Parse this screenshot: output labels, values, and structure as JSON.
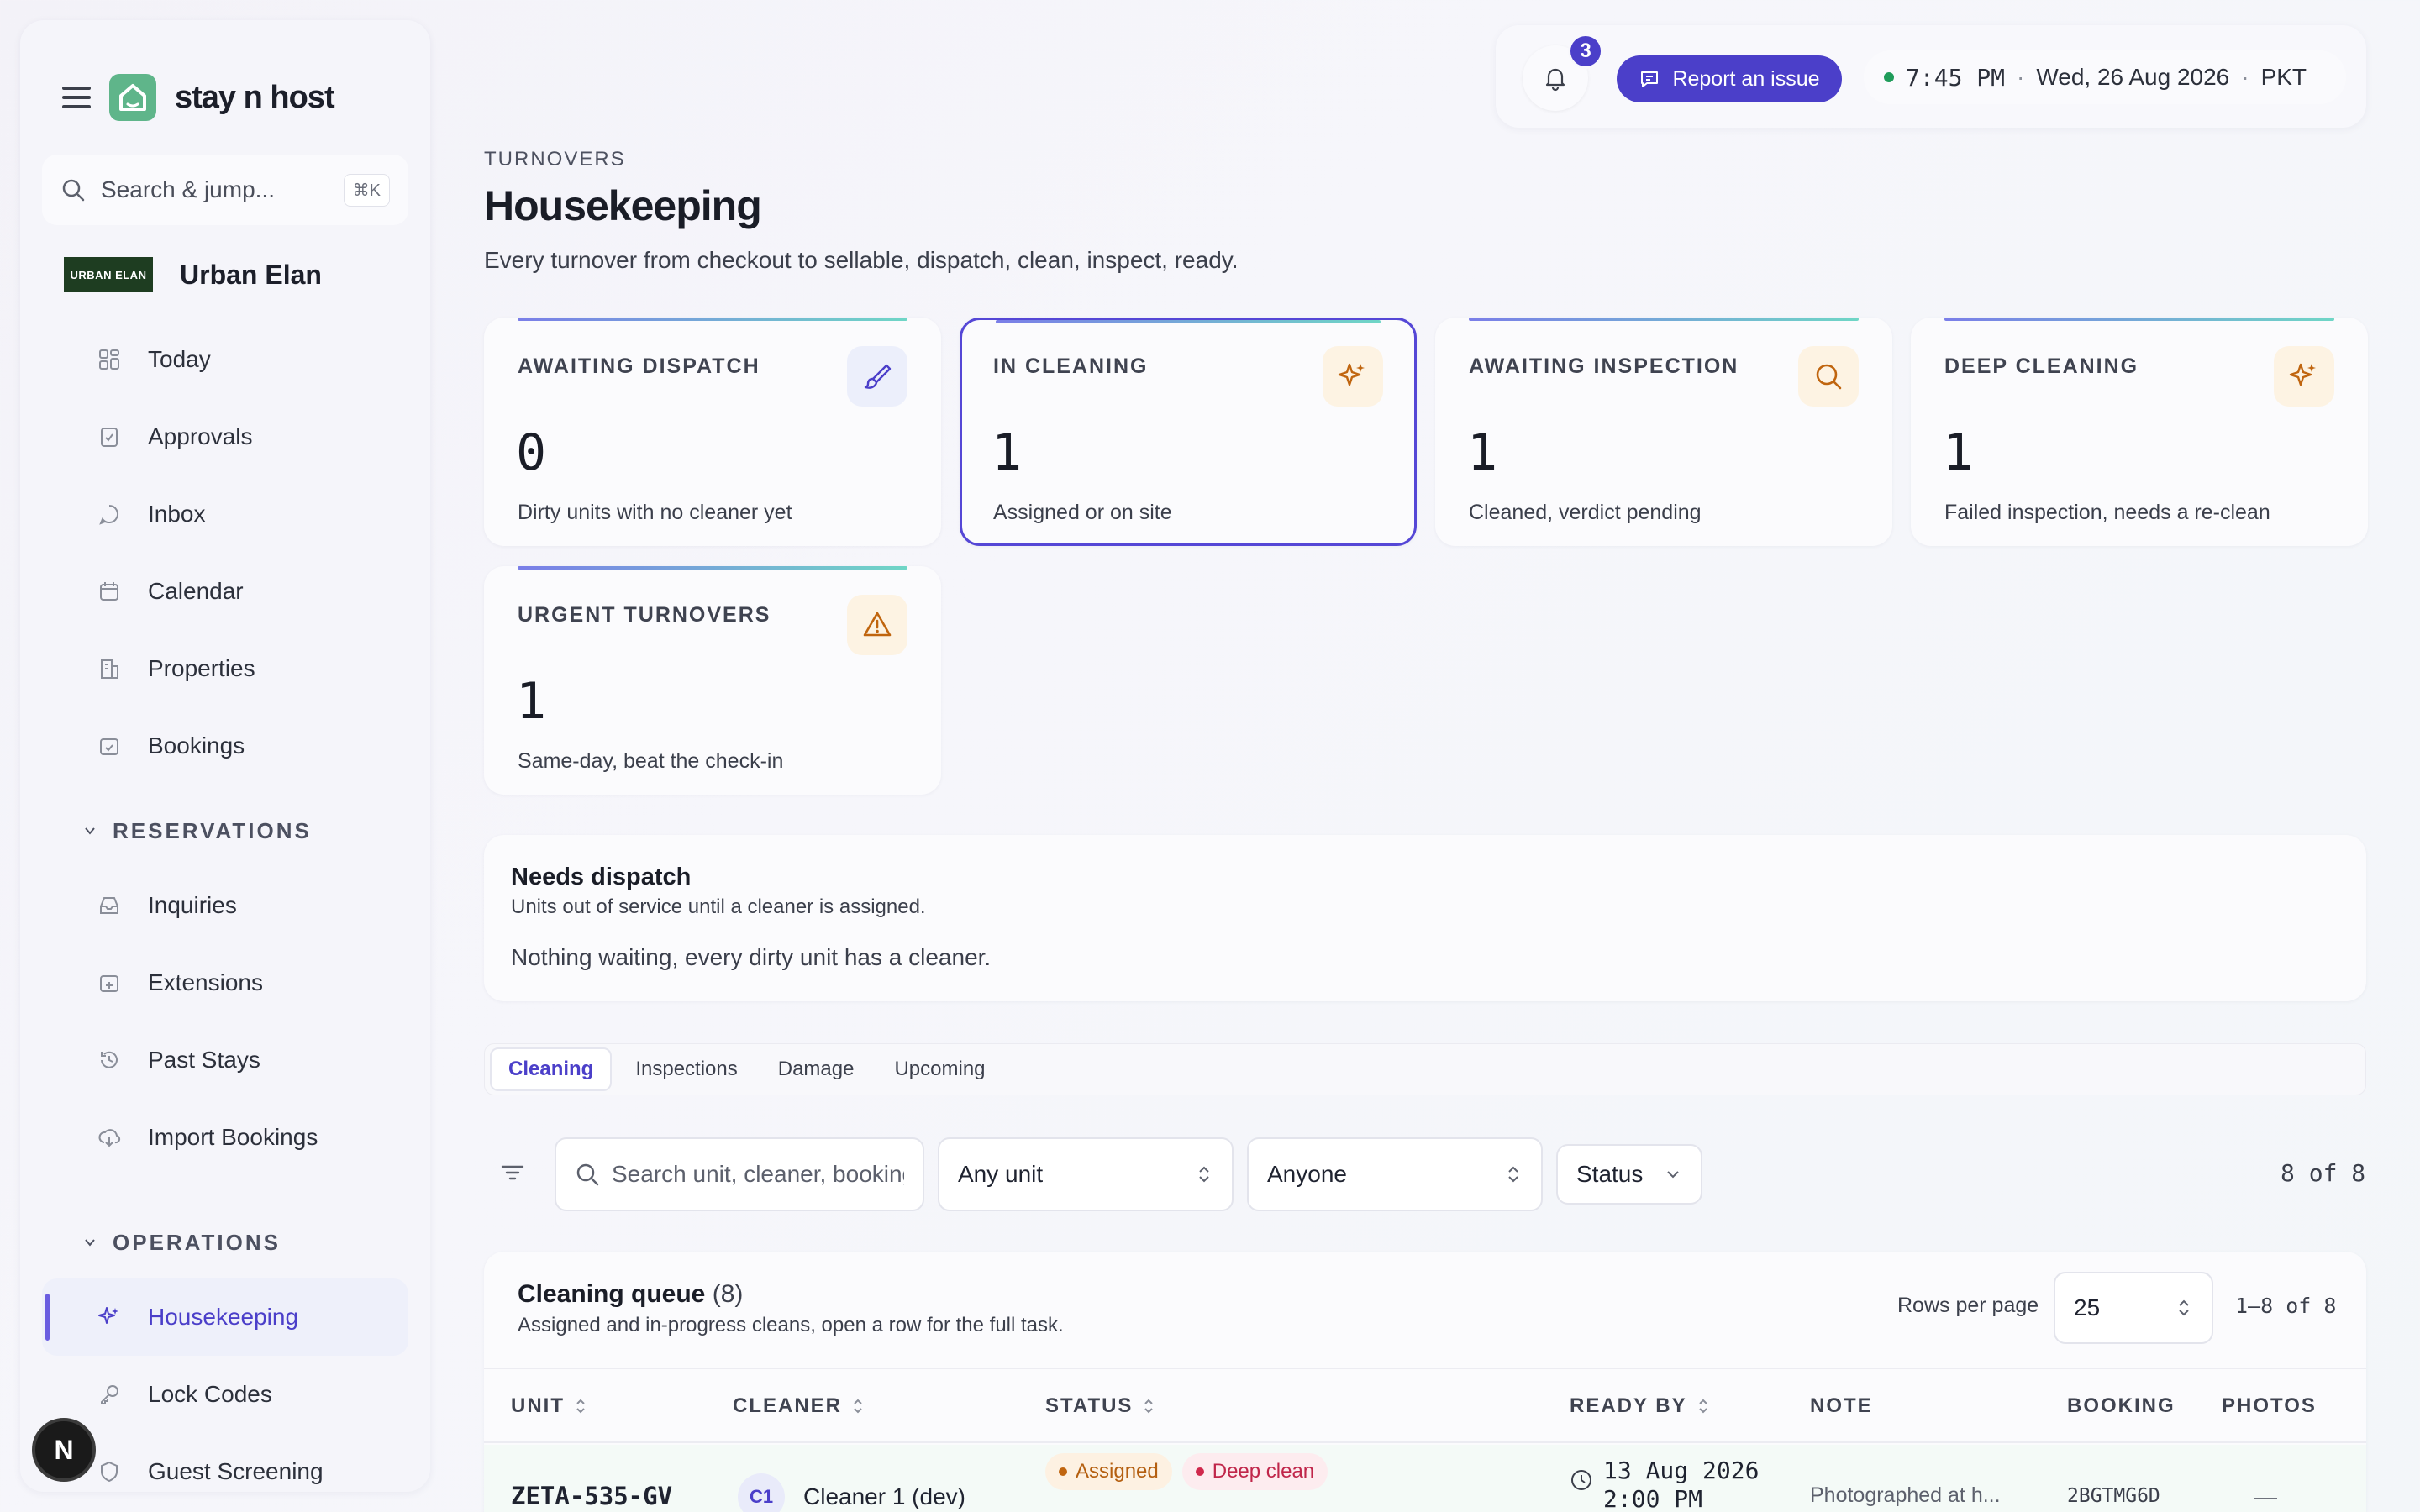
{
  "app": {
    "brand": "stay n host"
  },
  "sidebar": {
    "search_placeholder": "Search & jump...",
    "search_shortcut": "⌘K",
    "org_logo_text": "URBAN ELAN",
    "org_name": "Urban Elan",
    "items_top": [
      {
        "label": "Today",
        "icon": "grid-icon"
      },
      {
        "label": "Approvals",
        "icon": "clipboard-check-icon"
      },
      {
        "label": "Inbox",
        "icon": "chat-icon"
      },
      {
        "label": "Calendar",
        "icon": "calendar-icon"
      },
      {
        "label": "Properties",
        "icon": "building-icon"
      },
      {
        "label": "Bookings",
        "icon": "calendar-check-icon"
      }
    ],
    "section_reservations": "RESERVATIONS",
    "items_reservations": [
      {
        "label": "Inquiries",
        "icon": "inbox-tray-icon"
      },
      {
        "label": "Extensions",
        "icon": "calendar-plus-icon"
      },
      {
        "label": "Past Stays",
        "icon": "history-icon"
      },
      {
        "label": "Import Bookings",
        "icon": "cloud-download-icon"
      }
    ],
    "section_operations": "OPERATIONS",
    "items_operations": [
      {
        "label": "Housekeeping",
        "icon": "sparkle-icon",
        "active": true
      },
      {
        "label": "Lock Codes",
        "icon": "key-icon"
      },
      {
        "label": "Guest Screening",
        "icon": "shield-icon"
      }
    ],
    "user_initial": "N"
  },
  "topbar": {
    "notifications_count": "3",
    "report_label": "Report an issue",
    "time": "7:45 PM",
    "date": "Wed, 26 Aug 2026",
    "timezone": "PKT",
    "separator": "·"
  },
  "header": {
    "eyebrow": "TURNOVERS",
    "title": "Housekeeping",
    "subtitle": "Every turnover from checkout to sellable, dispatch, clean, inspect, ready."
  },
  "stats": [
    {
      "label": "AWAITING DISPATCH",
      "value": "0",
      "desc": "Dirty units with no cleaner yet",
      "icon": "brush-icon",
      "icon_bg": "#eceffb",
      "icon_color": "#4b3fc9"
    },
    {
      "label": "IN CLEANING",
      "value": "1",
      "desc": "Assigned or on site",
      "icon": "sparkle-icon",
      "icon_bg": "#fdf3e3",
      "icon_color": "#c0650f"
    },
    {
      "label": "AWAITING INSPECTION",
      "value": "1",
      "desc": "Cleaned, verdict pending",
      "icon": "search-icon",
      "icon_bg": "#fdf3e3",
      "icon_color": "#c0650f"
    },
    {
      "label": "DEEP CLEANING",
      "value": "1",
      "desc": "Failed inspection, needs a re-clean",
      "icon": "sparkle-icon",
      "icon_bg": "#fdf3e3",
      "icon_color": "#c0650f"
    },
    {
      "label": "URGENT TURNOVERS",
      "value": "1",
      "desc": "Same-day, beat the check-in",
      "icon": "warning-icon",
      "icon_bg": "#fdf3e3",
      "icon_color": "#c0650f"
    }
  ],
  "dispatch": {
    "title": "Needs dispatch",
    "subtitle": "Units out of service until a cleaner is assigned.",
    "empty": "Nothing waiting, every dirty unit has a cleaner."
  },
  "tabs": [
    "Cleaning",
    "Inspections",
    "Damage",
    "Upcoming"
  ],
  "filters": {
    "search_placeholder": "Search unit, cleaner, booking",
    "unit": "Any unit",
    "assignee": "Anyone",
    "status": "Status",
    "count": "8 of 8"
  },
  "queue": {
    "title": "Cleaning queue",
    "count": "(8)",
    "subtitle": "Assigned and in-progress cleans, open a row for the full task.",
    "rows_per_page_label": "Rows per page",
    "rows_per_page": "25",
    "range": "1–8 of 8",
    "columns": [
      "UNIT",
      "CLEANER",
      "STATUS",
      "READY BY",
      "NOTE",
      "BOOKING",
      "PHOTOS"
    ],
    "rows": [
      {
        "unit": "ZETA-535-GV",
        "cleaner_initials": "C1",
        "cleaner": "Cleaner 1 (dev)",
        "status": "Assigned",
        "tag": "Deep clean",
        "ready_date": "13 Aug 2026",
        "ready_time": "2:00 PM",
        "note": "Photographed at h...",
        "booking": "2BGTMG6D",
        "photos": "—"
      }
    ]
  }
}
